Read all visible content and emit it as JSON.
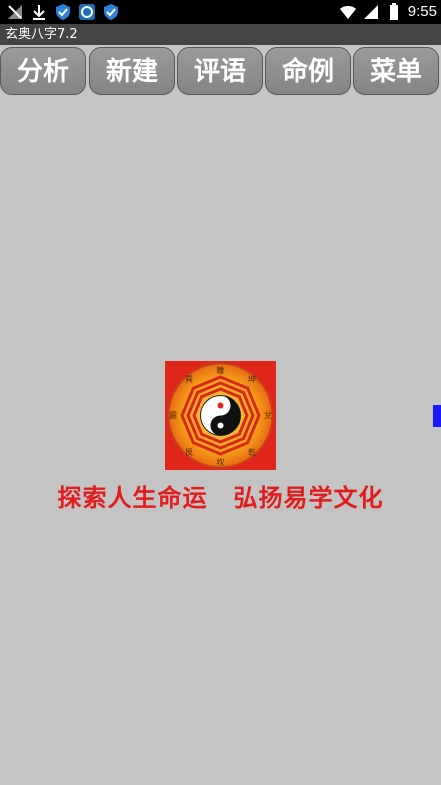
{
  "status_bar": {
    "time": "9:55",
    "left_icons": [
      "signal-crossed-icon",
      "download-icon",
      "shield-icon",
      "photo-app-icon",
      "shield-icon"
    ],
    "right_icons": [
      "wifi-icon",
      "cell-signal-icon",
      "battery-icon"
    ]
  },
  "app": {
    "title": "玄奥八字7.2"
  },
  "toolbar": {
    "buttons": [
      "分析",
      "新建",
      "评语",
      "命例",
      "菜单"
    ]
  },
  "logo": {
    "trigrams": [
      "離",
      "坤",
      "兌",
      "乾",
      "坎",
      "艮",
      "震",
      "巽"
    ]
  },
  "slogan": {
    "part1": "探索人生命运",
    "part2": "弘扬易学文化"
  },
  "colors": {
    "background": "#c4c4c4",
    "slogan": "#e31b1b",
    "logo_bg": "#e0251b"
  }
}
